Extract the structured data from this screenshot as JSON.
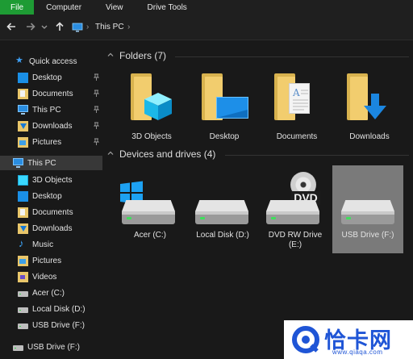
{
  "ribbon": {
    "tabs": [
      {
        "label": "File"
      },
      {
        "label": "Computer"
      },
      {
        "label": "View"
      },
      {
        "label": "Drive Tools"
      }
    ]
  },
  "address": {
    "back_icon": "arrow-left-icon",
    "forward_icon": "arrow-right-icon",
    "recent_icon": "chevron-down-icon",
    "up_icon": "arrow-up-icon",
    "crumbs": [
      {
        "label": "›"
      },
      {
        "label": "This PC"
      },
      {
        "label": "›"
      }
    ]
  },
  "sidebar": {
    "quick_access": {
      "label": "Quick access",
      "items": [
        {
          "label": "Desktop",
          "pinned": true
        },
        {
          "label": "Documents",
          "pinned": true
        },
        {
          "label": "This PC",
          "pinned": true
        },
        {
          "label": "Downloads",
          "pinned": true
        },
        {
          "label": "Pictures",
          "pinned": true
        }
      ]
    },
    "this_pc": {
      "label": "This PC",
      "items": [
        {
          "label": "3D Objects"
        },
        {
          "label": "Desktop"
        },
        {
          "label": "Documents"
        },
        {
          "label": "Downloads"
        },
        {
          "label": "Music"
        },
        {
          "label": "Pictures"
        },
        {
          "label": "Videos"
        },
        {
          "label": "Acer (C:)"
        },
        {
          "label": "Local Disk (D:)"
        },
        {
          "label": "USB Drive (F:)"
        }
      ]
    },
    "usb_root": {
      "label": "USB Drive (F:)"
    }
  },
  "content": {
    "folders": {
      "header": "Folders (7)",
      "items": [
        {
          "label": "3D Objects"
        },
        {
          "label": "Desktop"
        },
        {
          "label": "Documents"
        },
        {
          "label": "Downloads"
        }
      ]
    },
    "drives": {
      "header": "Devices and drives (4)",
      "items": [
        {
          "label": "Acer (C:)"
        },
        {
          "label": "Local Disk (D:)"
        },
        {
          "label": "DVD RW Drive\n(E:)"
        },
        {
          "label": "USB Drive (F:)"
        }
      ],
      "dvd_badge": "DVD"
    }
  },
  "watermark": {
    "text": "恰卡网",
    "sub": "www.qiaqa.com"
  },
  "colors": {
    "file_tab": "#1e9b34",
    "background": "#191919",
    "selected_tile": "#7a7a7a",
    "accent_blue": "#1a8fe6"
  }
}
